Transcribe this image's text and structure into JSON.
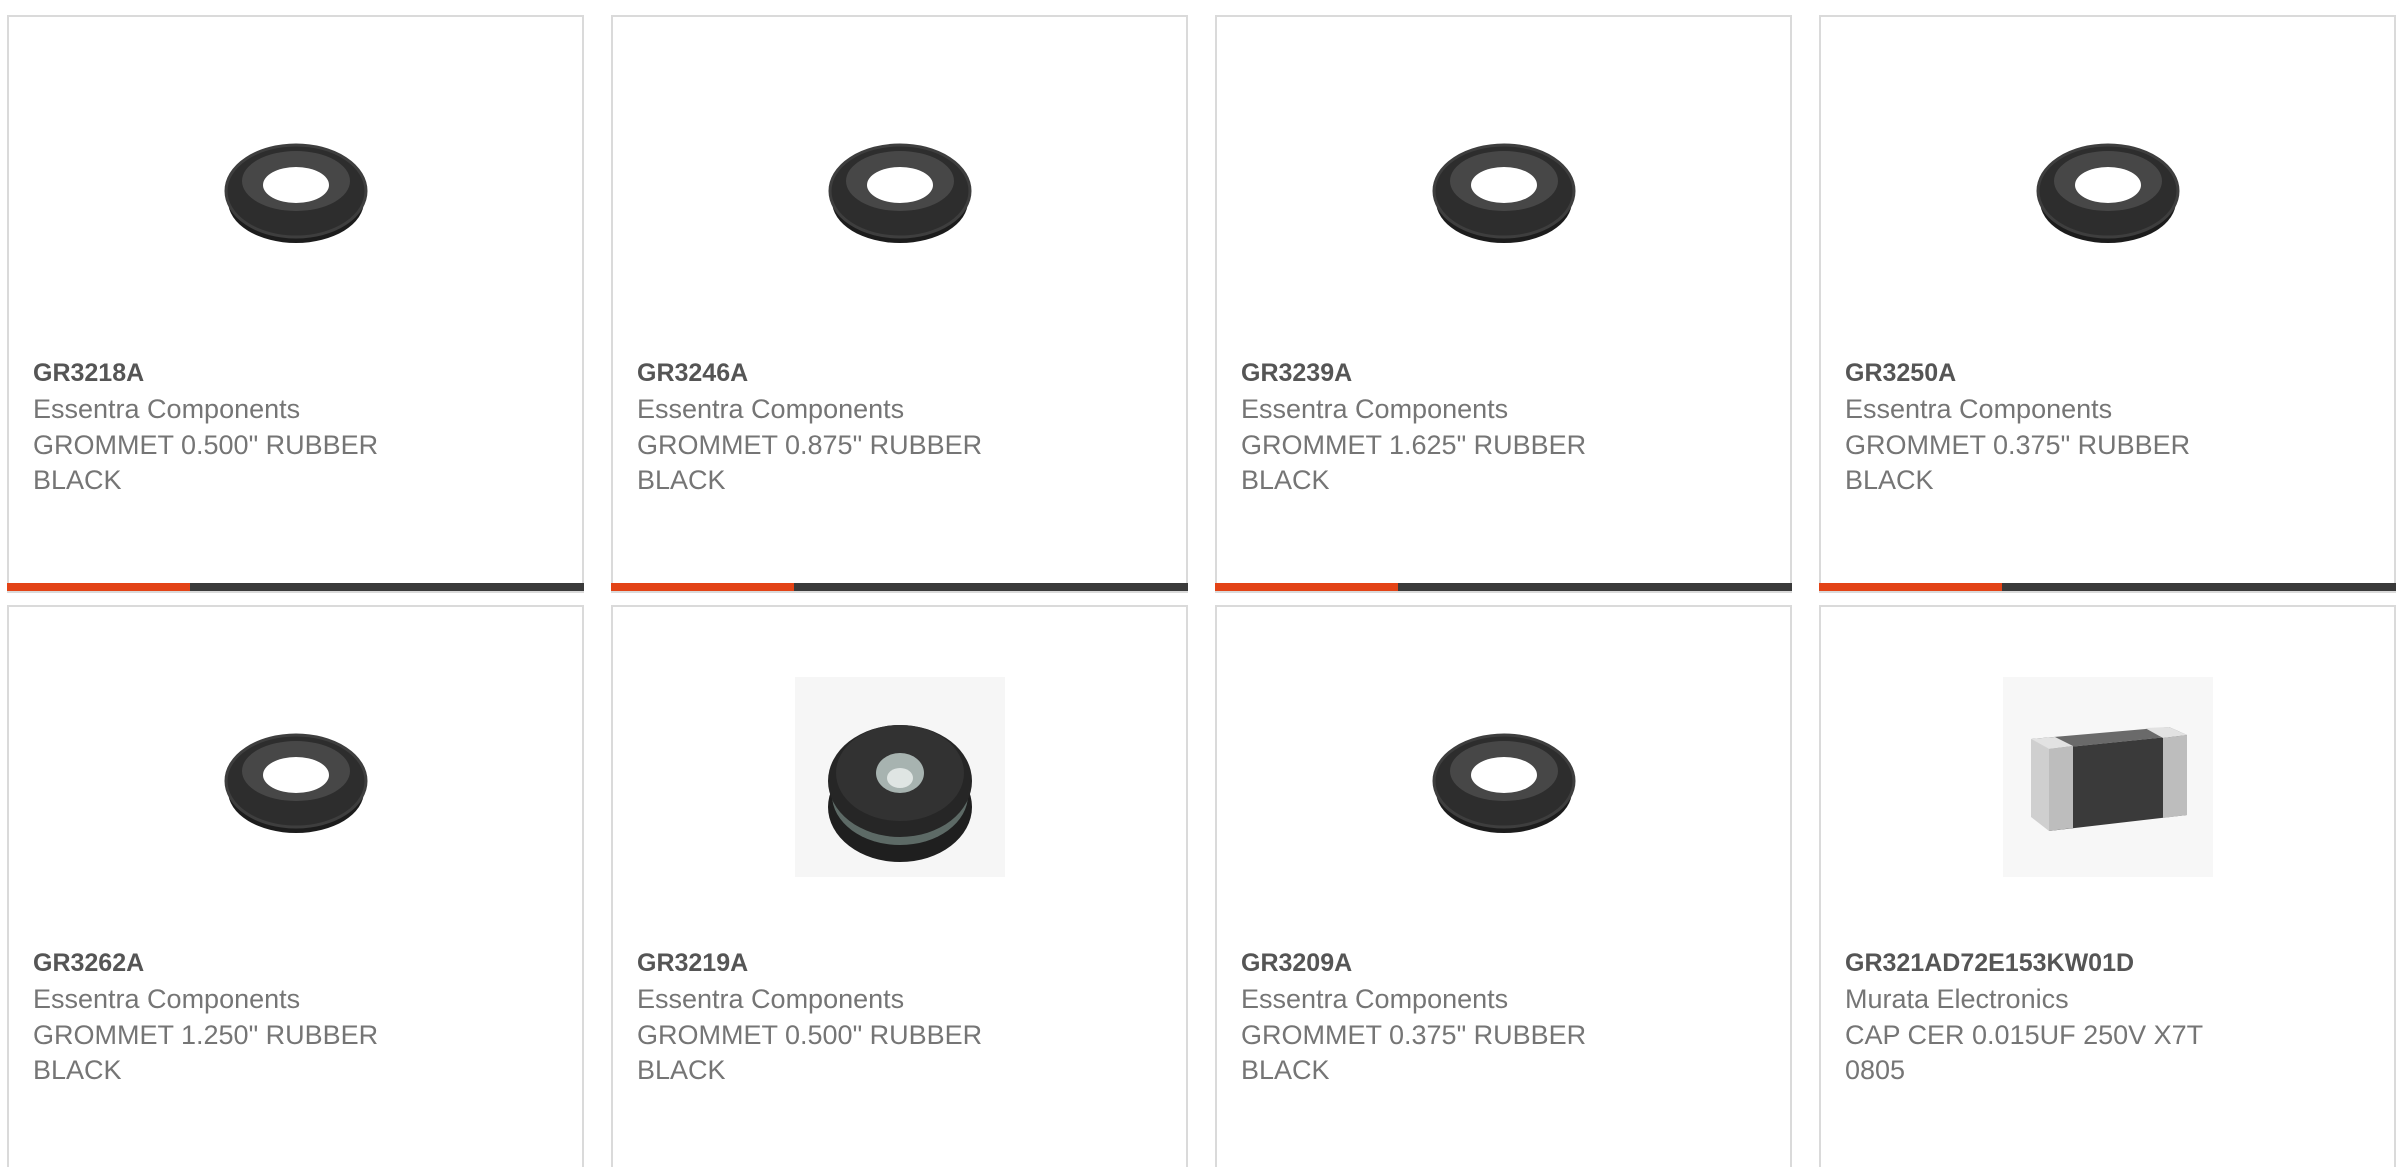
{
  "products": [
    {
      "part_number": "GR3218A",
      "manufacturer": "Essentra Components",
      "description": "GROMMET 0.500\" RUBBER BLACK",
      "image": "grommet-image"
    },
    {
      "part_number": "GR3246A",
      "manufacturer": "Essentra Components",
      "description": "GROMMET 0.875\" RUBBER BLACK",
      "image": "grommet-image"
    },
    {
      "part_number": "GR3239A",
      "manufacturer": "Essentra Components",
      "description": "GROMMET 1.625\" RUBBER BLACK",
      "image": "grommet-image"
    },
    {
      "part_number": "GR3250A",
      "manufacturer": "Essentra Components",
      "description": "GROMMET 0.375\" RUBBER BLACK",
      "image": "grommet-image"
    },
    {
      "part_number": "GR3262A",
      "manufacturer": "Essentra Components",
      "description": "GROMMET 1.250\" RUBBER BLACK",
      "image": "grommet-image"
    },
    {
      "part_number": "GR3219A",
      "manufacturer": "Essentra Components",
      "description": "GROMMET 0.500\" RUBBER BLACK",
      "image": "solid-grommet-image"
    },
    {
      "part_number": "GR3209A",
      "manufacturer": "Essentra Components",
      "description": "GROMMET 0.375\" RUBBER BLACK",
      "image": "grommet-image"
    },
    {
      "part_number": "GR321AD72E153KW01D",
      "manufacturer": "Murata Electronics",
      "description": "CAP CER 0.015UF 250V X7T 0805",
      "image": "ceramic-capacitor-image"
    }
  ],
  "colors": {
    "accent": "#e34316",
    "bar": "#3a3a3a",
    "border": "#dadada",
    "part_number": "#555555",
    "text": "#757575"
  }
}
